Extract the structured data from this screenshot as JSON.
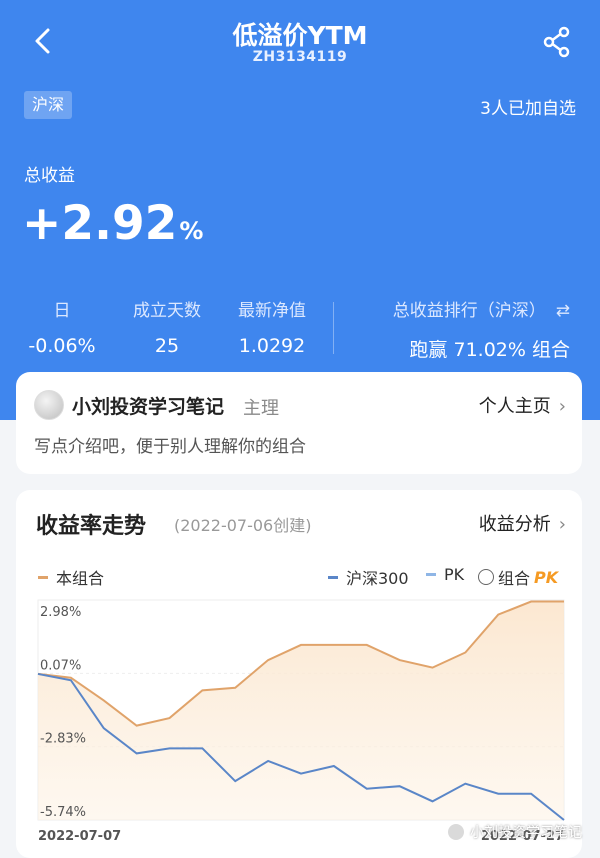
{
  "header": {
    "title": "低溢价YTM",
    "code": "ZH3134119",
    "market_tag": "沪深",
    "followers": "3人已加自选"
  },
  "summary": {
    "total_label": "总收益",
    "total_value": "+2.92",
    "total_unit": "%",
    "stats": [
      {
        "label": "日",
        "value": "-0.06%"
      },
      {
        "label": "成立天数",
        "value": "25"
      },
      {
        "label": "最新净值",
        "value": "1.0292"
      }
    ],
    "rank": {
      "label": "总收益排行（沪深）",
      "prefix": "跑赢",
      "value": "71.02%",
      "suffix": "组合"
    }
  },
  "owner": {
    "name": "小刘投资学习笔记",
    "role": "主理",
    "homepage": "个人主页",
    "intro": "写点介绍吧，便于别人理解你的组合"
  },
  "performance": {
    "title": "收益率走势",
    "created": "(2022-07-06创建)",
    "analysis": "收益分析",
    "legend": {
      "portfolio": "本组合",
      "benchmark": "沪深300",
      "pk": "PK",
      "compare": "组合",
      "pk_logo": "PK"
    }
  },
  "colors": {
    "hero": "#3f86ee",
    "portfolio": "#e0a36a",
    "benchmark": "#5a86c8"
  },
  "chart_data": {
    "type": "line",
    "x_start": "2022-07-07",
    "x_end": "2022-07-27",
    "y_ticks": [
      "2.98%",
      "0.07%",
      "-2.83%",
      "-5.74%"
    ],
    "ylim": [
      -5.74,
      2.98
    ],
    "series": [
      {
        "name": "本组合",
        "values": [
          0.05,
          -0.1,
          -1.0,
          -2.0,
          -1.7,
          -0.6,
          -0.5,
          0.6,
          1.2,
          1.2,
          1.2,
          0.6,
          0.3,
          0.9,
          2.4,
          2.92,
          2.92
        ]
      },
      {
        "name": "沪深300",
        "values": [
          0.05,
          -0.2,
          -2.1,
          -3.1,
          -2.9,
          -2.9,
          -4.2,
          -3.4,
          -3.9,
          -3.6,
          -4.5,
          -4.4,
          -5.0,
          -4.3,
          -4.7,
          -4.7,
          -5.74
        ]
      }
    ]
  },
  "watermark": "小刘投资学习笔记"
}
